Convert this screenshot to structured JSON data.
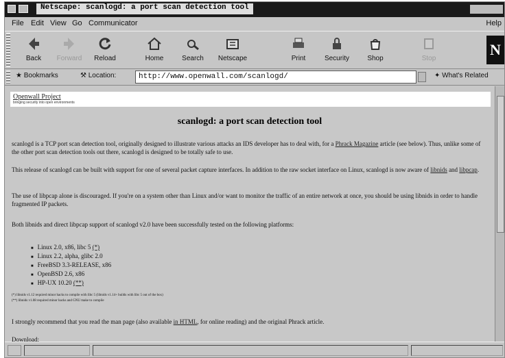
{
  "window": {
    "title": "Netscape: scanlogd: a port scan detection tool"
  },
  "menu": {
    "items": [
      "File",
      "Edit",
      "View",
      "Go",
      "Communicator"
    ],
    "help": "Help"
  },
  "toolbar": {
    "buttons": [
      {
        "label": "Back",
        "icon": "back-arrow-icon",
        "enabled": true
      },
      {
        "label": "Forward",
        "icon": "forward-arrow-icon",
        "enabled": false
      },
      {
        "label": "Reload",
        "icon": "reload-icon",
        "enabled": true
      },
      {
        "label": "Home",
        "icon": "home-icon",
        "enabled": true
      },
      {
        "label": "Search",
        "icon": "search-icon",
        "enabled": true
      },
      {
        "label": "Netscape",
        "icon": "netscape-icon",
        "enabled": true
      },
      {
        "label": "Print",
        "icon": "print-icon",
        "enabled": true
      },
      {
        "label": "Security",
        "icon": "lock-icon",
        "enabled": true
      },
      {
        "label": "Shop",
        "icon": "shop-icon",
        "enabled": true
      },
      {
        "label": "Stop",
        "icon": "stop-icon",
        "enabled": false
      }
    ],
    "logo": "N"
  },
  "location": {
    "bookmarks_label": "Bookmarks",
    "location_label": "Location:",
    "url": "http://www.openwall.com/scanlogd/",
    "related_label": "What's Related"
  },
  "page": {
    "banner_link": "Openwall Project",
    "banner_sub": "bringing security into open environments",
    "title": "scanlogd: a port scan detection tool",
    "p1_a": "scanlogd is a TCP port scan detection tool, originally designed to illustrate various attacks an IDS developer has to deal with, for a ",
    "p1_link": "Phrack Magazine",
    "p1_b": " article (see below). Thus, unlike some of the other port scan detection tools out there, scanlogd is designed to be totally safe to use.",
    "p2_a": "This release of scanlogd can be built with support for one of several packet capture interfaces. In addition to the raw socket interface on Linux, scanlogd is now aware of ",
    "p2_link1": "libnids",
    "p2_and": " and ",
    "p2_link2": "libpcap",
    "p2_end": ".",
    "p3": "The use of libpcap alone is discouraged. If you're on a system other than Linux and/or want to monitor the traffic of an entire network at once, you should be using libnids in order to handle fragmented IP packets.",
    "p4": "Both libnids and direct libpcap support of scanlogd v2.0 have been successfully tested on the following platforms:",
    "platforms": [
      {
        "text": "Linux 2.0, x86, libc 5",
        "note": "(*)"
      },
      {
        "text": "Linux 2.2, alpha, glibc 2.0",
        "note": ""
      },
      {
        "text": "FreeBSD 3.3-RELEASE, x86",
        "note": ""
      },
      {
        "text": "OpenBSD 2.6, x86",
        "note": ""
      },
      {
        "text": "HP-UX 10.20",
        "note": "(**)"
      }
    ],
    "foot1": "(*) libnids v1.12 required minor hacks to compile with libc 5 (libnids v1.14+ builds with libc 5 out of the box)",
    "foot2": "(**) libnids v1.08 required minor hacks and GNU make to compile",
    "p5_a": "I strongly recommend that you read the man page (also available ",
    "p5_link": "in HTML",
    "p5_b": ", for online reading) and the original Phrack article.",
    "download": "Download:"
  }
}
